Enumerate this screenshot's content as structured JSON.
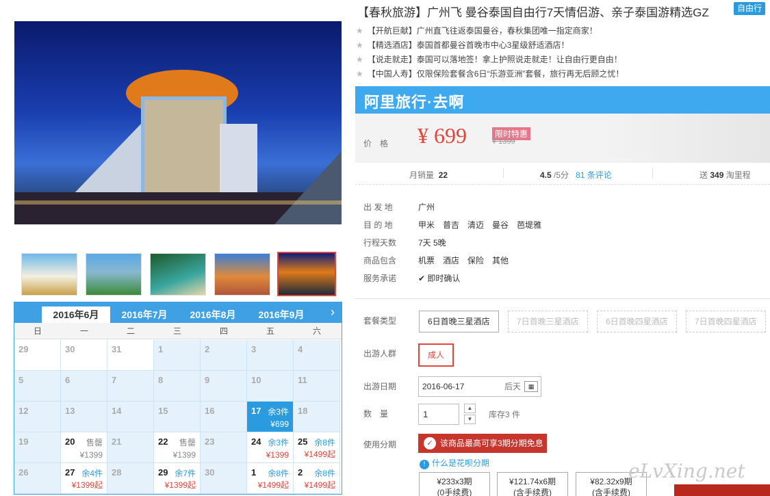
{
  "product": {
    "title": "【春秋旅游】广州飞 曼谷泰国自由行7天情侣游、亲子泰国游精选GZ",
    "tag": "自由行",
    "highlights": [
      "【开航巨献】广州直飞往返泰国曼谷，春秋集团唯一指定商家！",
      "【精选酒店】泰国首都曼谷首晚市中心3星级舒适酒店！",
      "【说走就走】泰国可以落地签！拿上护照说走就走！让自由行更自由！",
      "【中国人寿】仅限保险套餐含6日“乐游亚洲”套餐，旅行再无后顾之忧！"
    ]
  },
  "banner": {
    "text": "阿里旅行·去啊"
  },
  "price": {
    "label": "价　格",
    "value": "¥ 699",
    "badge": "限时特惠",
    "original": "¥ 1399"
  },
  "stats": {
    "monthly_label": "月销量",
    "monthly_value": "22",
    "rating": "4.5",
    "rating_suffix": "/5分",
    "reviews": "81 条评论",
    "points_prefix": "送",
    "points_value": "349",
    "points_suffix": "淘里程"
  },
  "details": [
    {
      "label": "出 发 地",
      "value": "广州"
    },
    {
      "label": "目 的 地",
      "value": "甲米　普吉　清迈　曼谷　芭堤雅"
    },
    {
      "label": "行程天数",
      "value": "7天 5晚"
    },
    {
      "label": "商品包含",
      "value": "机票　酒店　保险　其他"
    },
    {
      "label": "服务承诺",
      "value": "即时确认"
    }
  ],
  "form": {
    "package_label": "套餐类型",
    "packages": [
      "6日首晚三星酒店",
      "7日首晚三星酒店",
      "6日首晚四星酒店",
      "7日首晚四星酒店"
    ],
    "people_label": "出游人群",
    "people_option": "成人",
    "date_label": "出游日期",
    "date_value": "2016-06-17",
    "date_suffix": "后天",
    "qty_label": "数　量",
    "qty_value": "1",
    "stock": "库存3 件",
    "installment_label": "使用分期",
    "installment_button": "该商品最高可享3期分期免息",
    "huabei_link": "什么是花呗分期",
    "plans": [
      {
        "line1": "¥233x3期",
        "line2": "(0手续费)"
      },
      {
        "line1": "¥121.74x6期",
        "line2": "(含手续费)"
      },
      {
        "line1": "¥82.32x9期",
        "line2": "(含手续费)"
      }
    ]
  },
  "calendar": {
    "tabs": [
      "2016年6月",
      "2016年7月",
      "2016年8月",
      "2016年9月"
    ],
    "weekdays": [
      "日",
      "一",
      "二",
      "三",
      "四",
      "五",
      "六"
    ],
    "rows": [
      [
        {
          "d": "29"
        },
        {
          "d": "30"
        },
        {
          "d": "31"
        },
        {
          "d": "1"
        },
        {
          "d": "2"
        },
        {
          "d": "3"
        },
        {
          "d": "4"
        }
      ],
      [
        {
          "d": "5"
        },
        {
          "d": "6"
        },
        {
          "d": "7"
        },
        {
          "d": "8"
        },
        {
          "d": "9"
        },
        {
          "d": "10"
        },
        {
          "d": "11"
        }
      ],
      [
        {
          "d": "12"
        },
        {
          "d": "13"
        },
        {
          "d": "14"
        },
        {
          "d": "15"
        },
        {
          "d": "16"
        },
        {
          "d": "17",
          "s": "余3件",
          "p": "¥699",
          "sel": true
        },
        {
          "d": "18"
        }
      ],
      [
        {
          "d": "19"
        },
        {
          "d": "20",
          "s": "售罄",
          "p": "¥1399",
          "act": true
        },
        {
          "d": "21"
        },
        {
          "d": "22",
          "s": "售罄",
          "p": "¥1399",
          "act": true
        },
        {
          "d": "23"
        },
        {
          "d": "24",
          "s": "余3件",
          "p": "¥1399",
          "act": true,
          "blue": true,
          "red": true
        },
        {
          "d": "25",
          "s": "余8件",
          "p": "¥1499起",
          "act": true,
          "blue": true,
          "red": true
        }
      ],
      [
        {
          "d": "26"
        },
        {
          "d": "27",
          "s": "余4件",
          "p": "¥1399起",
          "act": true,
          "blue": true,
          "red": true
        },
        {
          "d": "28"
        },
        {
          "d": "29",
          "s": "余7件",
          "p": "¥1399起",
          "act": true,
          "blue": true,
          "red": true
        },
        {
          "d": "30"
        },
        {
          "d": "1",
          "s": "余8件",
          "p": "¥1499起",
          "act": true,
          "blue": true,
          "red": true
        },
        {
          "d": "2",
          "s": "余8件",
          "p": "¥1499起",
          "act": true,
          "blue": true,
          "red": true
        }
      ]
    ]
  },
  "watermark": "eLvXing.net"
}
